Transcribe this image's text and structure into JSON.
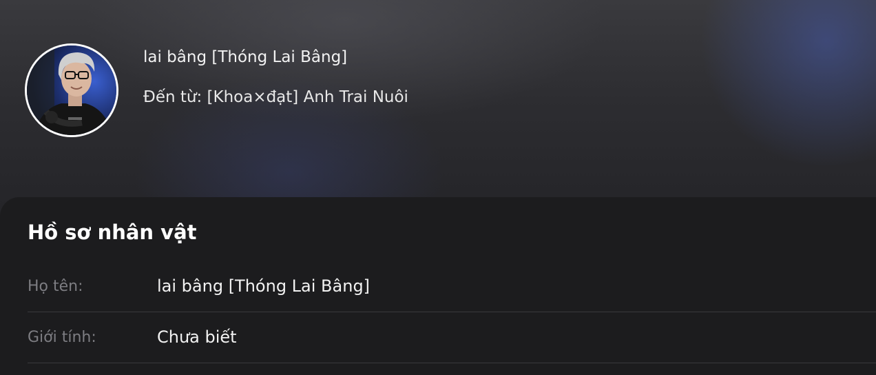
{
  "header": {
    "name": "lai bâng [Thóng Lai Bâng]",
    "from": "Đến từ: [Khoa×đạt] Anh Trai Nuôi",
    "avatar_icon": "character-avatar"
  },
  "profile": {
    "title": "Hồ sơ nhân vật",
    "rows": [
      {
        "label": "Họ tên:",
        "value": "lai bâng [Thóng Lai Bâng]"
      },
      {
        "label": "Giới tính:",
        "value": "Chưa biết"
      }
    ]
  },
  "colors": {
    "background": "#1c1c1e",
    "accent_glow": "#465aaa",
    "label": "#7d7d82",
    "text": "#f2f2f2"
  }
}
